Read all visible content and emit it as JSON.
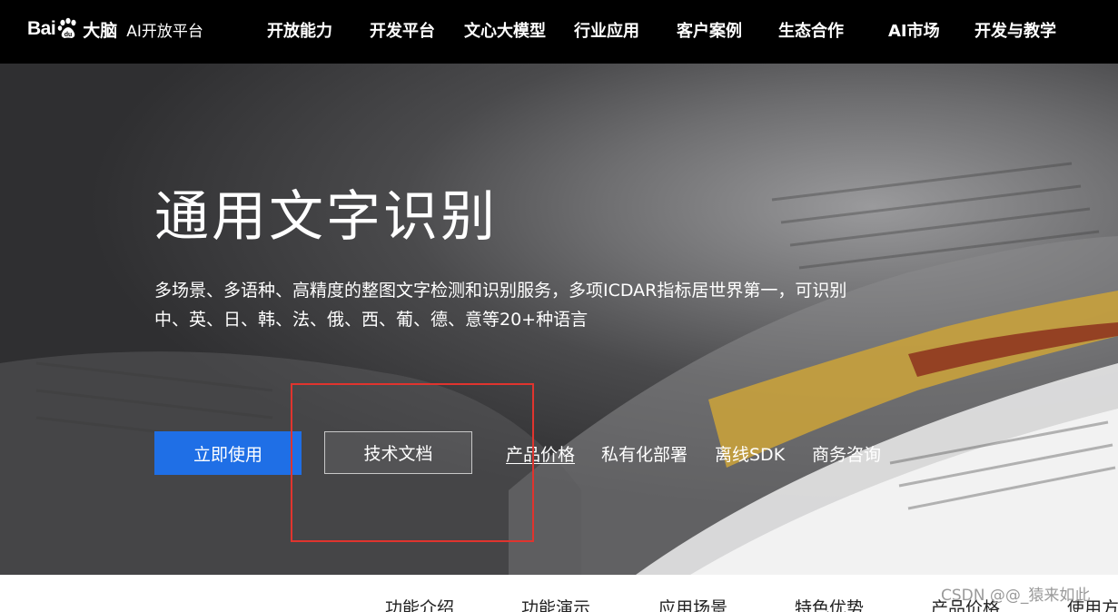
{
  "header": {
    "logo_bai": "Bai",
    "logo_brain": "大脑",
    "logo_sub": "AI开放平台",
    "nav": [
      "开放能力",
      "开发平台",
      "文心大模型",
      "行业应用",
      "客户案例",
      "生态合作",
      "AI市场",
      "开发与教学"
    ]
  },
  "hero": {
    "title": "通用文字识别",
    "desc": "多场景、多语种、高精度的整图文字检测和识别服务，多项ICDAR指标居世界第一，可识别中、英、日、韩、法、俄、西、葡、德、意等20+种语言",
    "primary_button": "立即使用",
    "secondary_button": "技术文档",
    "links": [
      "产品价格",
      "私有化部署",
      "离线SDK",
      "商务咨询"
    ]
  },
  "tabs": [
    "功能介绍",
    "功能演示",
    "应用场景",
    "特色优势",
    "产品价格",
    "使用方"
  ],
  "watermark": "CSDN @@_猿来如此",
  "colors": {
    "nav_bg": "#000000",
    "primary": "#1f6fe6",
    "highlight_box": "#e0342e"
  }
}
